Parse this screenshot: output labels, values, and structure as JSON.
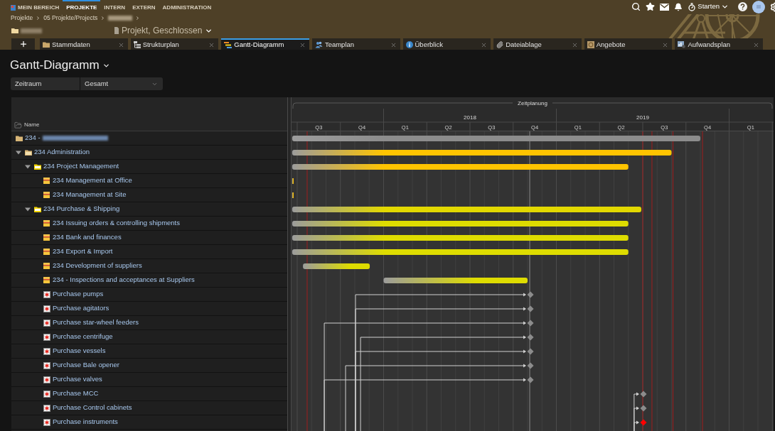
{
  "nav": {
    "items": [
      {
        "label": "MEIN BEREICH",
        "selected": false
      },
      {
        "label": "PROJEKTE",
        "selected": true
      },
      {
        "label": "INTERN",
        "selected": false
      },
      {
        "label": "EXTERN",
        "selected": false
      },
      {
        "label": "ADMINISTRATION",
        "selected": false
      }
    ]
  },
  "toolbar": {
    "start_label": "Starten"
  },
  "breadcrumb": {
    "items": [
      "Projekte",
      "05 Projekte/Projects"
    ],
    "blurred_tail": true
  },
  "project": {
    "blurred_name": true,
    "status": "Projekt, Geschlossen"
  },
  "tabs": [
    {
      "label": "Stammdaten",
      "selected": false
    },
    {
      "label": "Strukturplan",
      "selected": false
    },
    {
      "label": "Gantt-Diagramm",
      "selected": true
    },
    {
      "label": "Teamplan",
      "selected": false
    },
    {
      "label": "Überblick",
      "selected": false
    },
    {
      "label": "Dateiablage",
      "selected": false
    },
    {
      "label": "Angebote",
      "selected": false
    },
    {
      "label": "Aufwandsplan",
      "selected": false
    }
  ],
  "page": {
    "title": "Gantt-Diagramm",
    "filter": {
      "label": "Zeitraum",
      "value": "Gesamt"
    }
  },
  "tree": {
    "column": "Name",
    "items": [
      {
        "label": "234 -",
        "kind": "project",
        "blurred": true,
        "children": [
          {
            "label": "234 Administration",
            "kind": "phase",
            "expanded": true,
            "children": [
              {
                "label": "234 Project Management",
                "kind": "group",
                "expanded": true,
                "children": [
                  {
                    "label": "234 Management at Office",
                    "kind": "task"
                  },
                  {
                    "label": "234 Management at Site",
                    "kind": "task"
                  }
                ]
              },
              {
                "label": "234 Purchase & Shipping",
                "kind": "group",
                "expanded": true,
                "children": [
                  {
                    "label": "234 Issuing orders & controlling shipments",
                    "kind": "task"
                  },
                  {
                    "label": "234 Bank and finances",
                    "kind": "task"
                  },
                  {
                    "label": "234 Export & Import",
                    "kind": "task"
                  },
                  {
                    "label": "234 Development of suppliers",
                    "kind": "task"
                  },
                  {
                    "label": "234 - Inspections and acceptances at Suppliers",
                    "kind": "task"
                  },
                  {
                    "label": "Purchase pumps",
                    "kind": "milestone"
                  },
                  {
                    "label": "Purchase agitators",
                    "kind": "milestone"
                  },
                  {
                    "label": "Purchase star-wheel feeders",
                    "kind": "milestone"
                  },
                  {
                    "label": "Purchase centrifuge",
                    "kind": "milestone"
                  },
                  {
                    "label": "Purchase vessels",
                    "kind": "milestone"
                  },
                  {
                    "label": "Purchase Bale opener",
                    "kind": "milestone"
                  },
                  {
                    "label": "Purchase valves",
                    "kind": "milestone"
                  },
                  {
                    "label": "Purchase MCC",
                    "kind": "milestone"
                  },
                  {
                    "label": "Purchase Control cabinets",
                    "kind": "milestone"
                  },
                  {
                    "label": "Purchase instruments",
                    "kind": "milestone"
                  }
                ]
              }
            ]
          }
        ]
      }
    ]
  },
  "gantt": {
    "title": "Zeitplanung",
    "years": [
      {
        "quarters": [
          "Q3",
          "Q4"
        ]
      },
      {
        "label": "2018",
        "quarters": [
          "Q1",
          "Q2",
          "Q3",
          "Q4"
        ]
      },
      {
        "label": "2019",
        "quarters": [
          "Q1",
          "Q2",
          "Q3",
          "Q4"
        ]
      },
      {
        "quarters": [
          "Q1"
        ]
      }
    ]
  }
}
